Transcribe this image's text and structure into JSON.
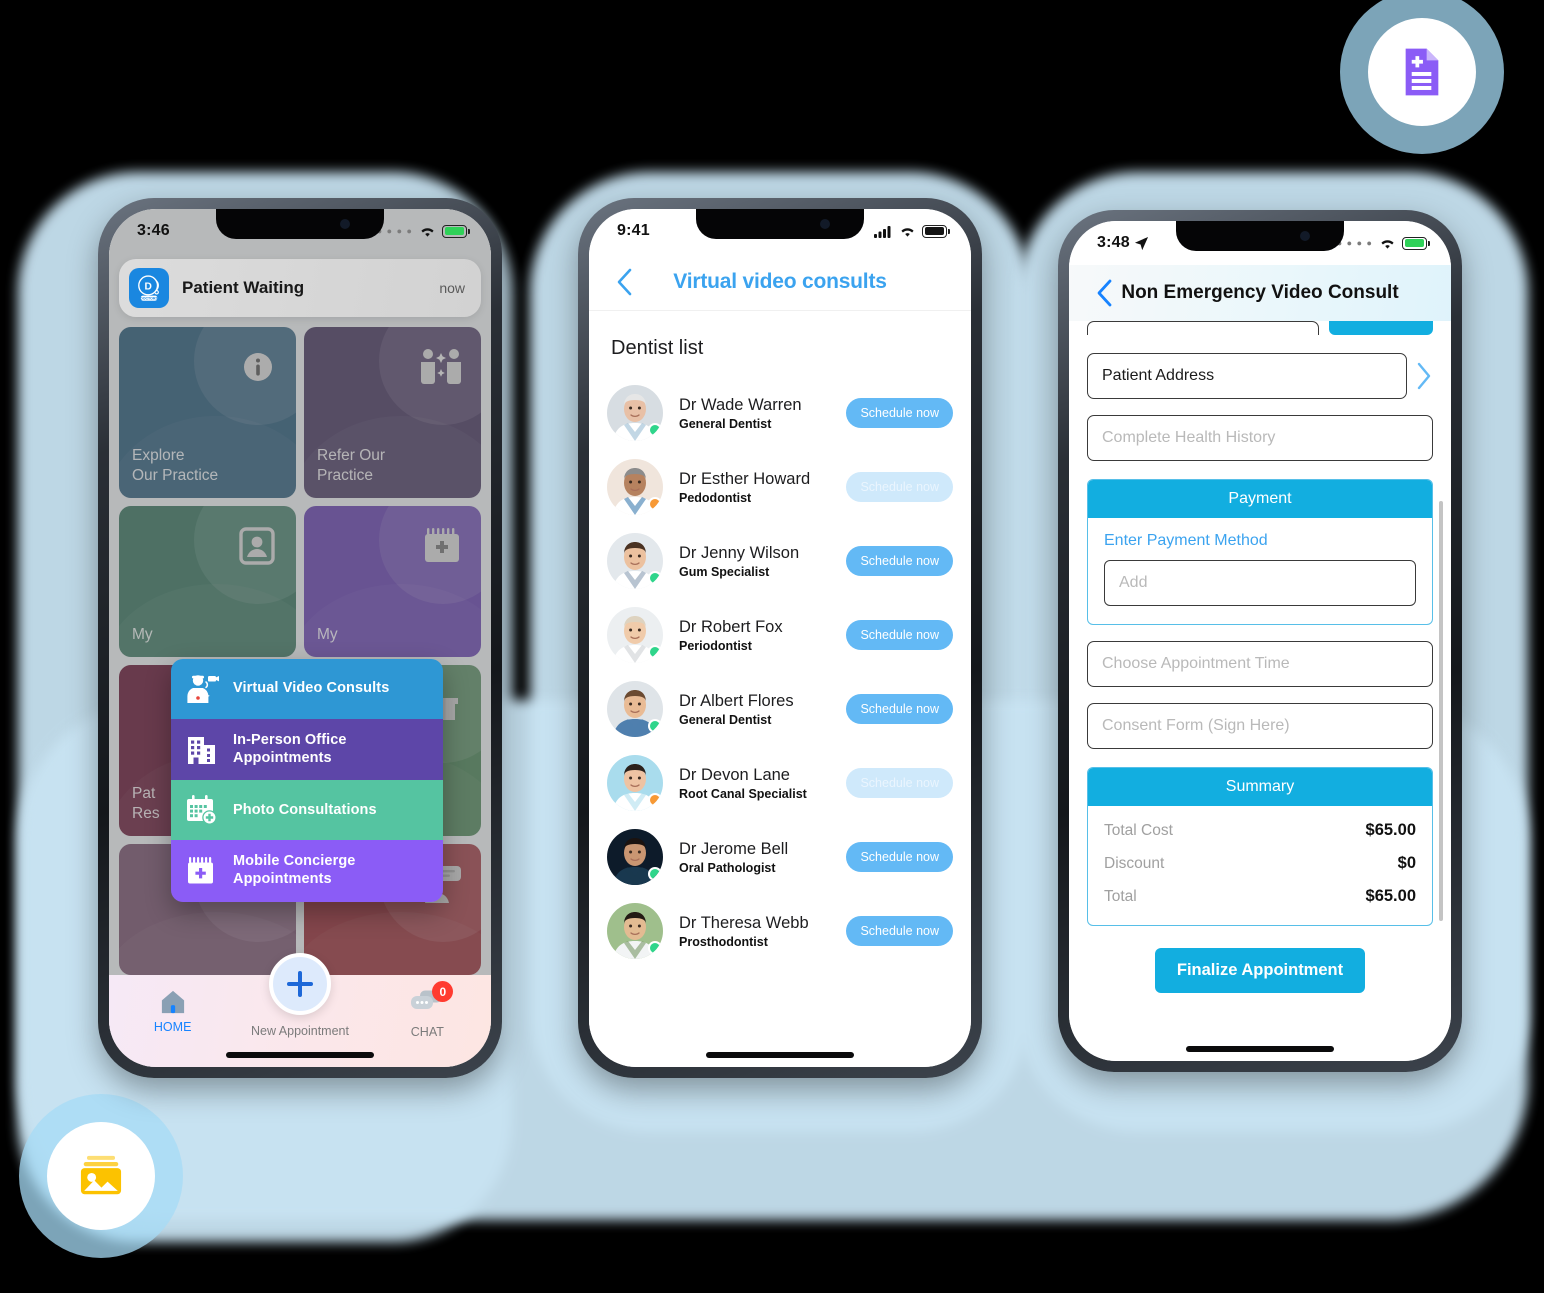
{
  "background": {
    "blob_color": "#c8e3f2",
    "canvas": "#000000"
  },
  "floating_badges": [
    {
      "name": "medical-document-badge",
      "icon": "document-plus-icon",
      "color": "#8b5cf6"
    },
    {
      "name": "image-gallery-badge",
      "icon": "image-icon",
      "color": "#fcc200"
    }
  ],
  "phone1": {
    "status": {
      "time": "3:46",
      "signal": "....",
      "wifi": "wifi-icon",
      "battery": "charging"
    },
    "notification": {
      "app_icon": "doctor-app-icon",
      "title": "Patient Waiting",
      "timestamp": "now"
    },
    "tiles": [
      {
        "label": "Explore\nOur Practice",
        "color": "#1d5070",
        "icon": "info-icon"
      },
      {
        "label": "Refer Our\nPractice",
        "color": "#3b2a55",
        "icon": "referral-people-icon"
      },
      {
        "label": "My",
        "color": "#2c6b55",
        "icon": "profile-card-icon"
      },
      {
        "label": "My",
        "color": "#5b35a8",
        "icon": "calendar-plus-icon"
      },
      {
        "label": "Pat\nRes",
        "color": "#5b0828",
        "icon": "trophy-icon"
      },
      {
        "label": "",
        "color": "#3f7b4b",
        "icon": "gift-icon"
      },
      {
        "label": "",
        "color": "#6e4563",
        "icon": "list-icon"
      },
      {
        "label": "",
        "color": "#8e1e28",
        "icon": "support-chat-icon"
      }
    ],
    "popup_menu": [
      {
        "label": "Virtual Video Consults",
        "color": "#2e97d4",
        "icon": "video-doctor-icon"
      },
      {
        "label": "In-Person Office Appointments",
        "color": "#5d46a8",
        "icon": "office-building-icon"
      },
      {
        "label": "Photo Consultations",
        "color": "#55c4a1",
        "icon": "calendar-photo-icon"
      },
      {
        "label": "Mobile Concierge Appointments",
        "color": "#8b5cf6",
        "icon": "mobile-calendar-icon"
      }
    ],
    "tabbar": {
      "home_label": "HOME",
      "mid_label": "New Appointment",
      "chat_label": "CHAT",
      "chat_badge": "0",
      "accent": "#1783ff"
    }
  },
  "phone2": {
    "status": {
      "time": "9:41",
      "signal": "signal-bars-icon",
      "wifi": "wifi-icon",
      "battery": "full"
    },
    "header": {
      "back": "chevron-left-icon",
      "title": "Virtual video consults",
      "accent": "#3ba3ef"
    },
    "list_title": "Dentist list",
    "button_label": "Schedule now",
    "dentists": [
      {
        "name": "Dr Wade Warren",
        "role": "General Dentist",
        "status": "online",
        "action_state": "active",
        "avatar_bg": "#d7dde2",
        "skin": "#e8c0a6",
        "hair": "#e6e6e6",
        "coat": "#ffffff",
        "accent": "#8fb6cf"
      },
      {
        "name": "Dr  Esther Howard",
        "role": "Pedodontist",
        "status": "busy",
        "action_state": "faded",
        "avatar_bg": "#f0e5dc",
        "skin": "#b6825f",
        "hair": "#8c8c8c",
        "coat": "#ffffff",
        "accent": "#2a6fa8"
      },
      {
        "name": "Dr Jenny Wilson",
        "role": "Gum Specialist",
        "status": "online",
        "action_state": "active",
        "avatar_bg": "#e3e8ec",
        "skin": "#ecc19f",
        "hair": "#4a3222",
        "coat": "#ffffff",
        "accent": "#7d93ab"
      },
      {
        "name": "Dr Robert Fox",
        "role": "Periodontist",
        "status": "online",
        "action_state": "active",
        "avatar_bg": "#eceff1",
        "skin": "#f0cbaa",
        "hair": "#ded3c0",
        "coat": "#ffffff",
        "accent": "#c8ccd0"
      },
      {
        "name": "Dr Albert Flores",
        "role": "General Dentist",
        "status": "online",
        "action_state": "active",
        "avatar_bg": "#dfe4e8",
        "skin": "#e9bb95",
        "hair": "#6b4a31",
        "coat": "#4f7fae",
        "accent": "#4f7fae"
      },
      {
        "name": "Dr Devon Lane",
        "role": "Root Canal Specialist",
        "status": "busy",
        "action_state": "faded",
        "avatar_bg": "#a9dced",
        "skin": "#eec3a3",
        "hair": "#2b211c",
        "coat": "#ffffff",
        "accent": "#a9dced"
      },
      {
        "name": "Dr Jerome Bell",
        "role": "Oral Pathologist",
        "status": "online",
        "action_state": "active",
        "avatar_bg": "#0d1b2a",
        "skin": "#c99672",
        "hair": "#1b1310",
        "coat": "#19384f",
        "accent": "#19384f"
      },
      {
        "name": "Dr Theresa Webb",
        "role": "Prosthodontist",
        "status": "online",
        "action_state": "active",
        "avatar_bg": "#9fbf8c",
        "skin": "#e3bb92",
        "hair": "#231a14",
        "coat": "#f2f4f5",
        "accent": "#6d8f5a"
      }
    ]
  },
  "phone3": {
    "status": {
      "time": "3:48",
      "location": "location-arrow-icon",
      "signal": "....",
      "wifi": "wifi-icon",
      "battery": "charging"
    },
    "header": {
      "back": "chevron-left-icon",
      "title": "Non Emergency Video Consult"
    },
    "fields": [
      {
        "name": "patient-address-field",
        "value": "Patient Address",
        "filled": true,
        "chevron": "chevron-right-icon"
      },
      {
        "name": "health-history-field",
        "value": "Complete Health History",
        "filled": false
      }
    ],
    "payment": {
      "header": "Payment",
      "label": "Enter Payment Method",
      "input_placeholder": "Add"
    },
    "more_fields": [
      {
        "name": "appointment-time-field",
        "value": "Choose Appointment Time"
      },
      {
        "name": "consent-form-field",
        "value": "Consent Form (Sign Here)"
      }
    ],
    "summary": {
      "header": "Summary",
      "rows": [
        {
          "label": "Total Cost",
          "value": "$65.00"
        },
        {
          "label": "Discount",
          "value": "$0"
        },
        {
          "label": "Total",
          "value": "$65.00"
        }
      ]
    },
    "finalize_label": "Finalize Appointment",
    "accent": "#12aee0"
  }
}
